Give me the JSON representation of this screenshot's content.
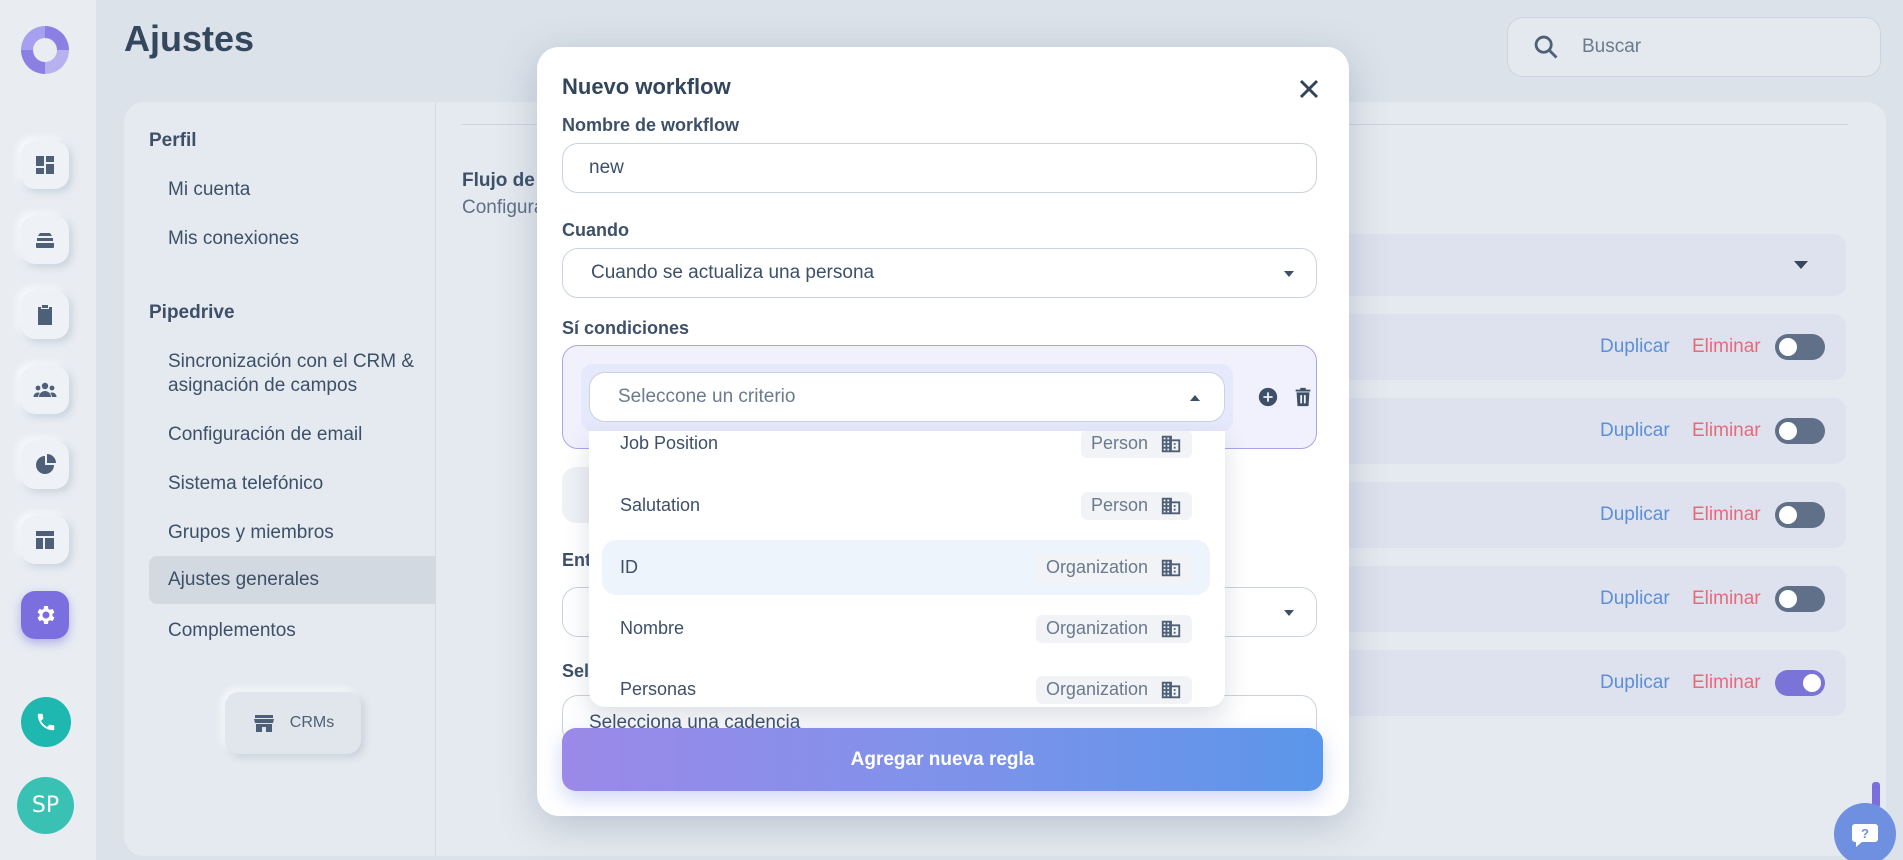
{
  "page": {
    "title": "Ajustes"
  },
  "search": {
    "placeholder": "Buscar"
  },
  "rail": {
    "items": [
      "dashboard-icon",
      "layers-icon",
      "clipboard-icon",
      "team-icon",
      "chart-icon",
      "layout-icon",
      "gear-icon"
    ],
    "phone": "phone-icon",
    "avatar_initials": "SP"
  },
  "settings_nav": {
    "section1": "Perfil",
    "profile_items": [
      "Mi cuenta",
      "Mis conexiones"
    ],
    "section2": "Pipedrive",
    "pipedrive_items": [
      "Sincronización con el CRM & asignación de campos",
      "Configuración de email",
      "Sistema telefónico",
      "Grupos y miembros",
      "Ajustes generales",
      "Complementos"
    ],
    "active_item": "Ajustes generales",
    "crms_button": "CRMs"
  },
  "content": {
    "flow_title": "Flujo de t",
    "flow_subtitle": "Configura",
    "rows": [
      {
        "duplicate": "Duplicar",
        "delete": "Eliminar",
        "enabled": false
      },
      {
        "duplicate": "Duplicar",
        "delete": "Eliminar",
        "enabled": false
      },
      {
        "duplicate": "Duplicar",
        "delete": "Eliminar",
        "enabled": false
      },
      {
        "duplicate": "Duplicar",
        "delete": "Eliminar",
        "enabled": false
      },
      {
        "duplicate": "Duplicar",
        "delete": "Eliminar",
        "enabled": true
      }
    ]
  },
  "modal": {
    "title": "Nuevo workflow",
    "name_label": "Nombre de workflow",
    "name_value": "new",
    "when_label": "Cuando",
    "when_value": "Cuando se actualiza una persona",
    "conditions_label": "Sí condiciones",
    "criterion_placeholder": "Seleccone un criterio",
    "hidden_label_1": "Ent",
    "hidden_label_2": "Sele",
    "cadence_value": "Selecciona una cadencia",
    "add_rule_button": "Agregar nueva regla",
    "dropdown_options": [
      {
        "label": "Job Position",
        "entity": "Person"
      },
      {
        "label": "Salutation",
        "entity": "Person"
      },
      {
        "label": "ID",
        "entity": "Organization",
        "hovered": true
      },
      {
        "label": "Nombre",
        "entity": "Organization"
      },
      {
        "label": "Personas",
        "entity": "Organization"
      }
    ]
  },
  "colors": {
    "accent": "#7b6fe0",
    "link": "#5b8fd8",
    "danger": "#e86a7a",
    "phone": "#1fb8b0",
    "button_gradient_start": "#9b89e8",
    "button_gradient_end": "#5b96ea"
  }
}
